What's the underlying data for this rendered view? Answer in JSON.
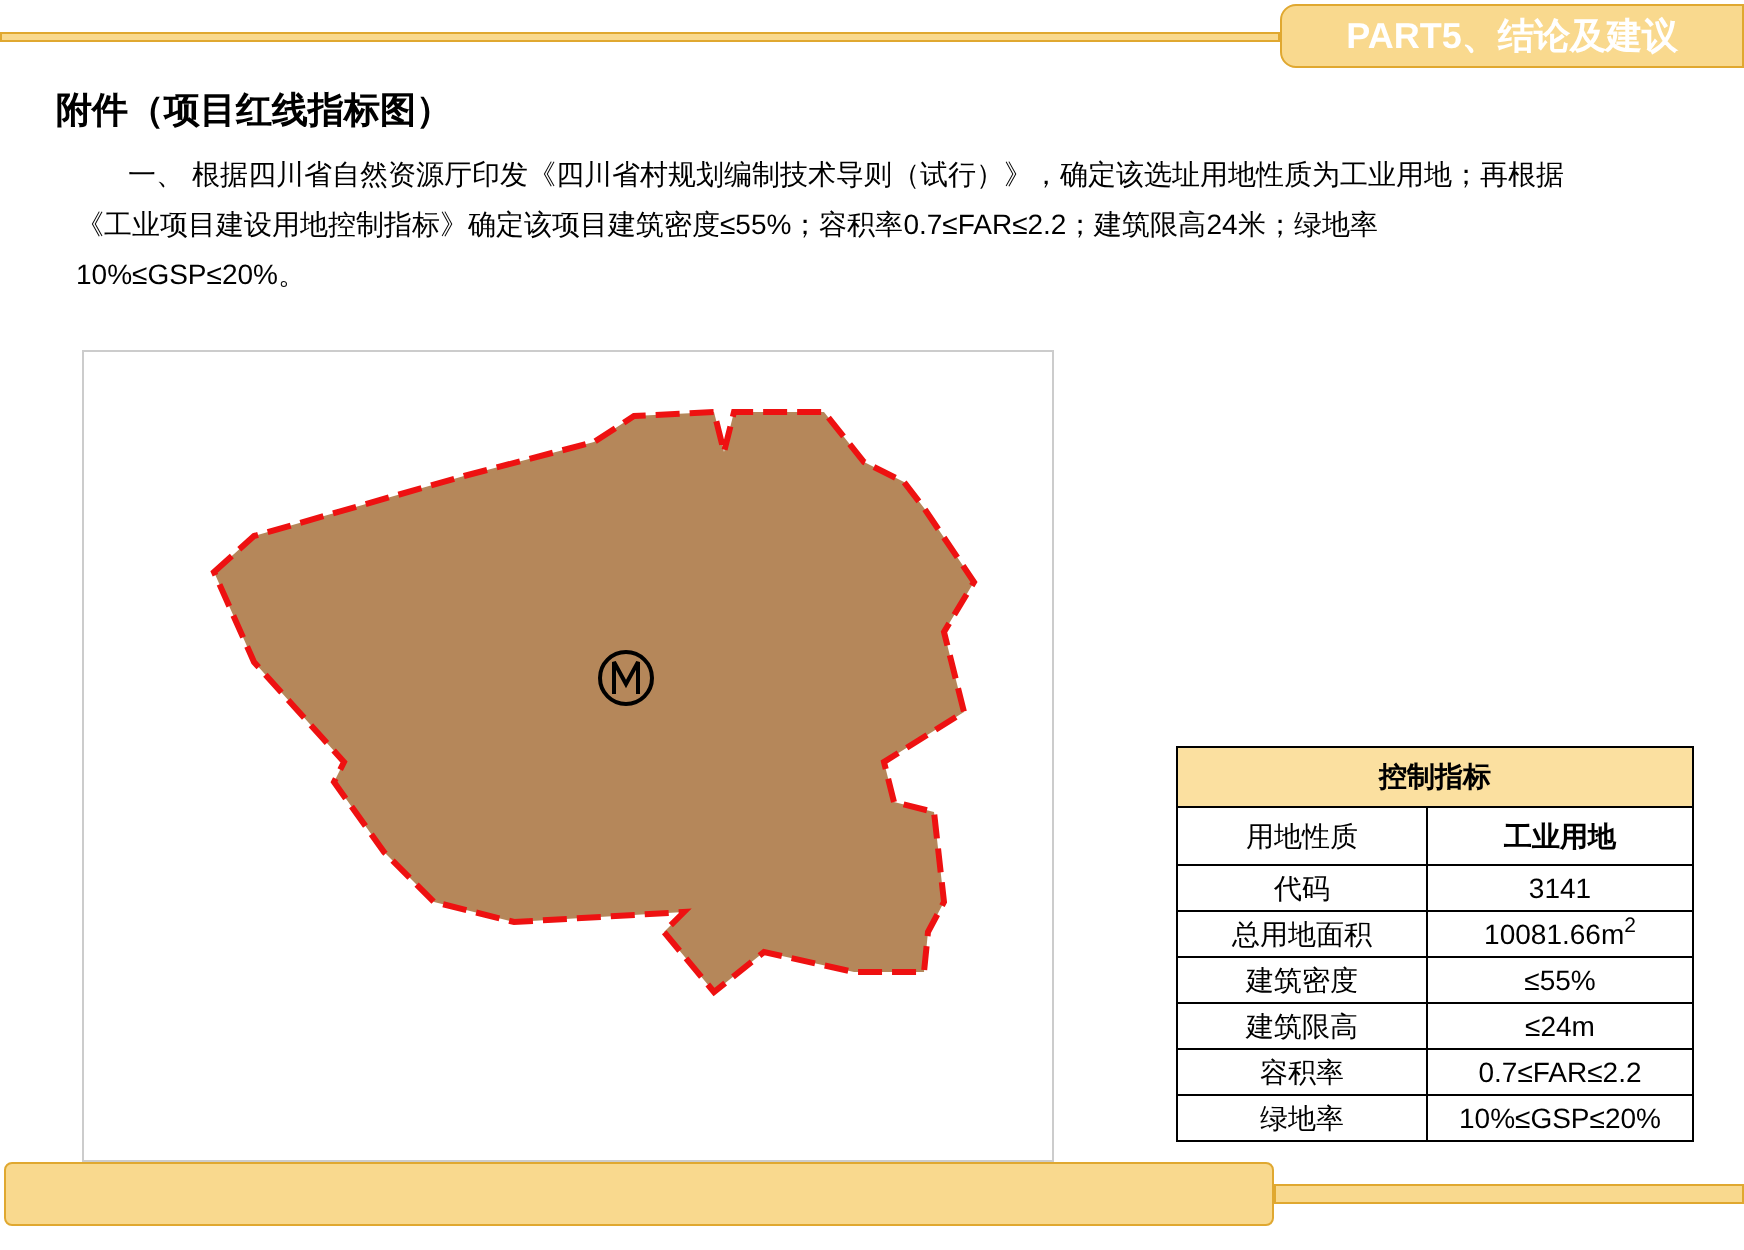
{
  "section_tab": {
    "label": "PART5、结论及建议"
  },
  "title": "附件（项目红线指标图）",
  "paragraph": [
    "一、 根据四川省自然资源厅印发《四川省村规划编制技术导则（试行）》，确定该选址用地性质为工业用地；再根据",
    "《工业项目建设用地控制指标》确定该项目建筑密度≤55%；容积率0.7≤FAR≤2.2；建筑限高24米；绿地率",
    "10%≤GSP≤20%。"
  ],
  "table": {
    "title": "控制指标",
    "rows": [
      {
        "label": "用地性质",
        "value": "**工业用地**"
      },
      {
        "label": "代码",
        "value": "3141"
      },
      {
        "label": "总用地面积",
        "value": "10081.66m$^{2}$"
      },
      {
        "label": "建筑密度",
        "value": "≤55%"
      },
      {
        "label": "建筑限高",
        "value": "≤24m"
      },
      {
        "label": "容积率",
        "value": "0.7≤FAR≤2.2"
      },
      {
        "label": "绿地率",
        "value": "10%≤GSP≤20%"
      }
    ]
  }
}
